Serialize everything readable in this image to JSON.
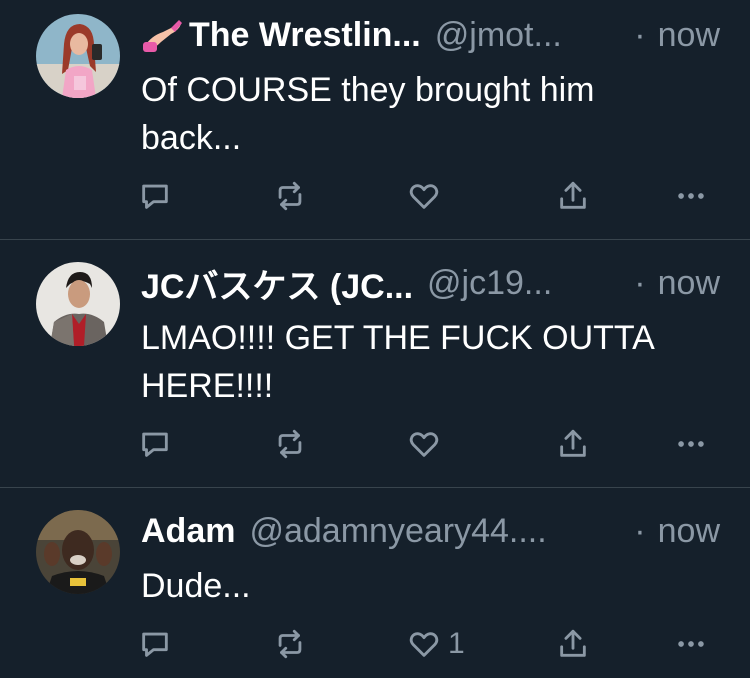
{
  "tweets": [
    {
      "name": "The Wrestlin...",
      "handle": "@jmot...",
      "sep": "·",
      "time": "now",
      "text": "Of COURSE they brought him\nback...",
      "avatar": "avatar-woman-pink-outfit",
      "emoji": "nail-polish-emoji",
      "reply_count": "",
      "retweet_count": "",
      "like_count": ""
    },
    {
      "name": "JCバスケス (JC...",
      "handle": "@jc19...",
      "sep": "·",
      "time": "now",
      "text": "LMAO!!!! GET THE FUCK OUTTA\nHERE!!!!",
      "avatar": "avatar-man-red-shirt-jacket",
      "reply_count": "",
      "retweet_count": "",
      "like_count": ""
    },
    {
      "name": "Adam",
      "handle": "@adamnyeary44....",
      "sep": "·",
      "time": "now",
      "text": "Dude...",
      "avatar": "avatar-man-hands-up",
      "reply_count": "",
      "retweet_count": "",
      "like_count": "1"
    }
  ],
  "icons": {
    "reply": "reply-icon",
    "retweet": "retweet-icon",
    "like": "heart-icon",
    "share": "share-icon",
    "more": "more-icon"
  },
  "colors": {
    "background": "#15202b",
    "muted": "#8b98a5",
    "divider": "#38444d",
    "text": "#ffffff"
  }
}
